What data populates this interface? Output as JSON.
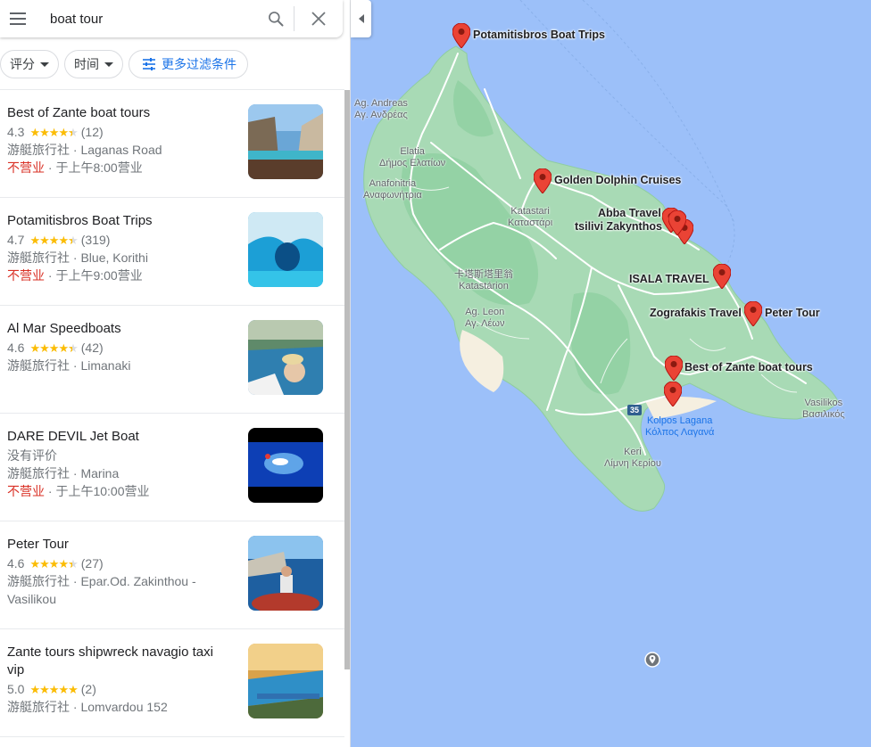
{
  "search": {
    "query": "boat tour"
  },
  "filters": {
    "rating_label": "评分",
    "time_label": "时间",
    "more_filters_label": "更多过滤条件"
  },
  "results": [
    {
      "title": "Best of Zante boat tours",
      "rating": "4.3",
      "stars": 4.3,
      "reviews": "(12)",
      "category": "游艇旅行社",
      "address": "Laganas Road",
      "status_closed": "不营业",
      "status_open": "于上午8:00营业"
    },
    {
      "title": "Potamitisbros Boat Trips",
      "rating": "4.7",
      "stars": 4.7,
      "reviews": "(319)",
      "category": "游艇旅行社",
      "address": "Blue, Korithi",
      "status_closed": "不营业",
      "status_open": "于上午9:00营业"
    },
    {
      "title": "Al Mar Speedboats",
      "rating": "4.6",
      "stars": 4.6,
      "reviews": "(42)",
      "category": "游艇旅行社",
      "address": "Limanaki"
    },
    {
      "title": "DARE DEVIL Jet Boat",
      "no_reviews": "没有评价",
      "category": "游艇旅行社",
      "address": "Marina",
      "status_closed": "不营业",
      "status_open": "于上午10:00营业"
    },
    {
      "title": "Peter Tour",
      "rating": "4.6",
      "stars": 4.6,
      "reviews": "(27)",
      "category": "游艇旅行社",
      "address": "Epar.Od. Zakinthou - Vasilikou"
    },
    {
      "title": "Zante tours shipwreck navagio taxi vip",
      "rating": "5.0",
      "stars": 5.0,
      "reviews": "(2)",
      "category": "游艇旅行社",
      "address": "Lomvardou 152"
    }
  ],
  "map": {
    "pin_labels": {
      "potamitisbros": "Potamitisbros Boat Trips",
      "golden_dolphin": "Golden Dolphin Cruises",
      "abba_travel": "Abba Travel",
      "tsilivi": "tsilivi Zakynthos",
      "isala": "ISALA TRAVEL",
      "zografakis": "Zografakis Travel",
      "peter_tour": "Peter Tour",
      "best_of_zante": "Best of Zante boat tours"
    },
    "towns": {
      "ag_andreas": "Ag. Andreas",
      "ag_andreas_gr": "Αγ. Ανδρέας",
      "elatia": "Elatia",
      "elatia_gr": "Δήμος Ελατίων",
      "anafonitria": "Anafonitria",
      "anafonitria_gr": "Αναφωνήτρια",
      "katastari": "Katastari",
      "katastari_gr": "Καταστάρι",
      "katastarion_cn": "卡塔斯塔里翁",
      "katastarion": "Katastárion",
      "ag_leon": "Ag. Leon",
      "ag_leon_gr": "Αγ. Λέων",
      "keri": "Keri",
      "keri_gr": "Λίμνη Κερίου",
      "vasilikos": "Vasilikos",
      "vasilikos_gr": "Βασιλικός"
    },
    "water": {
      "laganas": "Kolpos Lagana",
      "laganas_gr": "Κόλπος Λαγανά"
    },
    "road_badge": "35",
    "colors": {
      "sea": "#9cc0f9",
      "land": "#a8dab5",
      "land_dark": "#94d2a5",
      "sand": "#f5efe0",
      "road": "#ffffff",
      "pin": "#ea4335"
    }
  }
}
